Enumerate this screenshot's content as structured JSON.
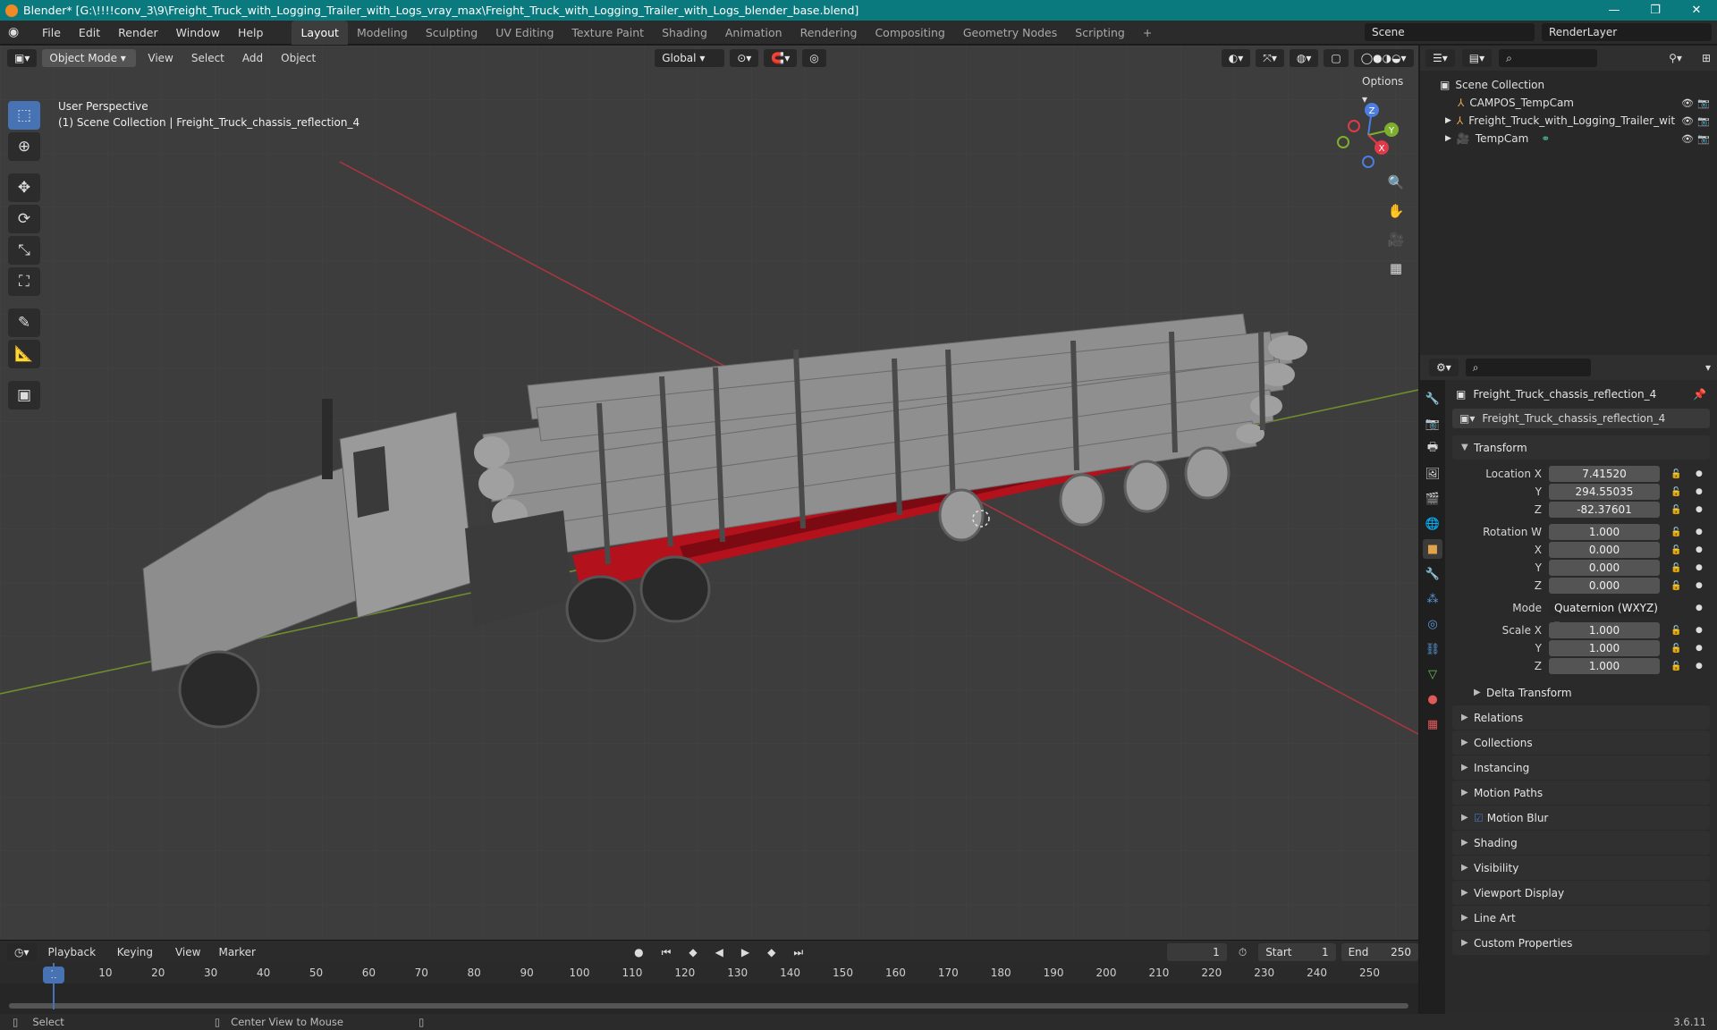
{
  "titlebar": {
    "title": "Blender* [G:\\!!!!conv_3\\9\\Freight_Truck_with_Logging_Trailer_with_Logs_vray_max\\Freight_Truck_with_Logging_Trailer_with_Logs_blender_base.blend]",
    "minimize": "—",
    "restore": "❐",
    "close": "✕"
  },
  "menubar": {
    "menus": [
      "File",
      "Edit",
      "Render",
      "Window",
      "Help"
    ],
    "workspaces": [
      "Layout",
      "Modeling",
      "Sculpting",
      "UV Editing",
      "Texture Paint",
      "Shading",
      "Animation",
      "Rendering",
      "Compositing",
      "Geometry Nodes",
      "Scripting"
    ],
    "active_workspace": "Layout",
    "add_workspace": "+",
    "scene": "Scene",
    "view_layer": "RenderLayer"
  },
  "viewport": {
    "mode": "Object Mode",
    "menus": [
      "View",
      "Select",
      "Add",
      "Object"
    ],
    "orientation": "Global",
    "options": "Options",
    "info_line1": "User Perspective",
    "info_line2": "(1) Scene Collection | Freight_Truck_chassis_reflection_4",
    "gizmo": {
      "z": "Z",
      "y": "Y",
      "x": "X"
    }
  },
  "outliner": {
    "root": "Scene Collection",
    "items": [
      {
        "name": "CAMPOS_TempCam"
      },
      {
        "name": "Freight_Truck_with_Logging_Trailer_wit"
      },
      {
        "name": "TempCam"
      }
    ]
  },
  "properties": {
    "object_name": "Freight_Truck_chassis_reflection_4",
    "data_name": "Freight_Truck_chassis_reflection_4",
    "transform_label": "Transform",
    "location": {
      "label": "Location X",
      "x": "7.41520",
      "y": "294.55035",
      "z": "-82.37601"
    },
    "rotation": {
      "label": "Rotation W",
      "w": "1.000",
      "x": "0.000",
      "y": "0.000",
      "z": "0.000"
    },
    "mode": {
      "label": "Mode",
      "value": "Quaternion (WXYZ)"
    },
    "scale": {
      "label": "Scale X",
      "x": "1.000",
      "y": "1.000",
      "z": "1.000"
    },
    "axis": {
      "y": "Y",
      "z": "Z",
      "x": "X"
    },
    "delta_transform": "Delta Transform",
    "panels": [
      "Relations",
      "Collections",
      "Instancing",
      "Motion Paths",
      "Motion Blur",
      "Shading",
      "Visibility",
      "Viewport Display",
      "Line Art",
      "Custom Properties"
    ]
  },
  "timeline": {
    "menus": [
      "Playback",
      "Keying",
      "View",
      "Marker"
    ],
    "current_frame": "1",
    "start_label": "Start",
    "start": "1",
    "end_label": "End",
    "end": "250",
    "ticks": [
      "10",
      "20",
      "30",
      "40",
      "50",
      "60",
      "70",
      "80",
      "90",
      "100",
      "110",
      "120",
      "130",
      "140",
      "150",
      "160",
      "170",
      "180",
      "190",
      "200",
      "210",
      "220",
      "230",
      "240",
      "250"
    ],
    "ruler_current": "1"
  },
  "statusbar": {
    "select": "Select",
    "center": "Center View to Mouse",
    "version": "3.6.11"
  },
  "colors": {
    "accent": "#4772b3",
    "titlebar": "#0b7a7e",
    "trailer_frame": "#b3111b",
    "logs": "#8c8c8c"
  }
}
